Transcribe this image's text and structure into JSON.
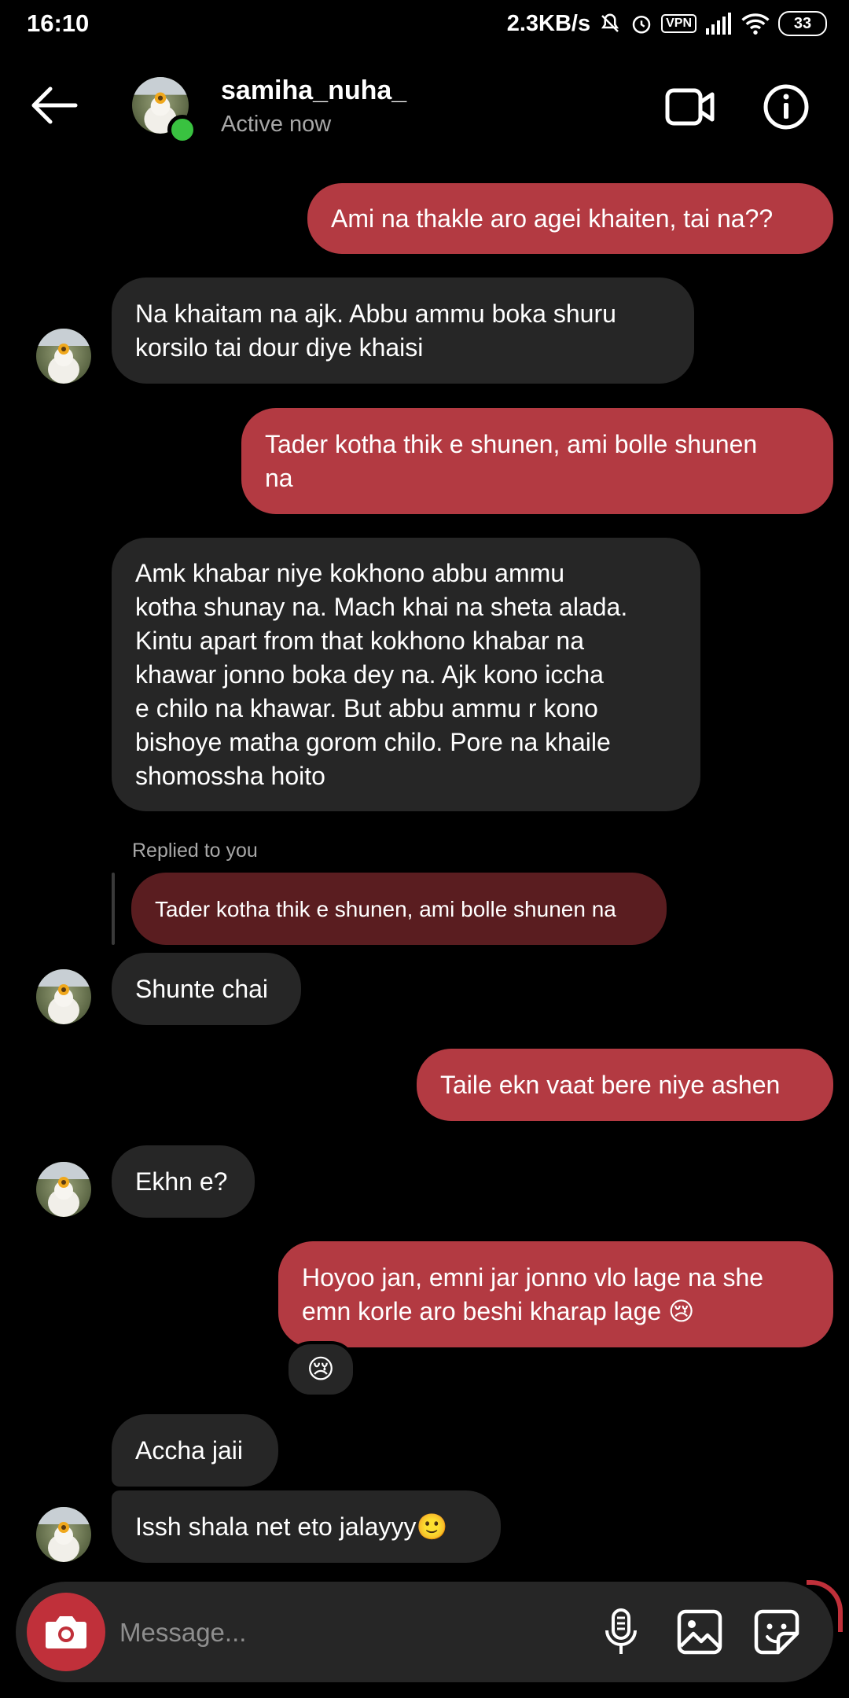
{
  "status_bar": {
    "time": "16:10",
    "speed": "2.3KB/s",
    "vpn": "VPN",
    "battery": "33"
  },
  "header": {
    "username": "samiha_nuha_",
    "status": "Active now"
  },
  "messages": [
    {
      "side": "out",
      "text": "Ami na thakle aro agei khaiten, tai na??"
    },
    {
      "side": "in",
      "text": "Na khaitam na ajk. Abbu ammu boka shuru\nkorsilo tai dour diye khaisi"
    },
    {
      "side": "out",
      "text": "Tader kotha thik e shunen, ami bolle shunen\nna"
    },
    {
      "side": "in",
      "text": "Amk khabar niye kokhono abbu ammu\nkotha shunay na. Mach khai na sheta alada.\nKintu apart from that kokhono khabar na\nkhawar jonno boka dey na. Ajk kono iccha\ne chilo na khawar. But abbu ammu r kono\nbishoye matha gorom chilo. Pore na khaile\nshomossha hoito"
    },
    {
      "side": "in",
      "reply_label": "Replied to you",
      "reply_text": "Tader kotha thik e shunen, ami bolle shunen na",
      "text": "Shunte chai"
    },
    {
      "side": "out",
      "text": "Taile ekn vaat bere niye ashen"
    },
    {
      "side": "in",
      "text": "Ekhn e?"
    },
    {
      "side": "out",
      "text": "Hoyoo jan, emni jar jonno vlo lage na she\nemn korle aro beshi kharap lage 😢",
      "reaction": "😢"
    },
    {
      "side": "in",
      "text": "Accha jaii"
    },
    {
      "side": "in",
      "text": "Issh shala net eto jalayyy🙂"
    }
  ],
  "composer": {
    "placeholder": "Message..."
  },
  "colors": {
    "outgoing_bubble": "#b33a42",
    "incoming_bubble": "#262626",
    "reply_bubble": "#5a1d20",
    "online": "#39c240",
    "camera": "#c0303a"
  },
  "icons": [
    "back-arrow-icon",
    "video-call-icon",
    "info-icon",
    "camera-icon",
    "microphone-icon",
    "gallery-icon",
    "sticker-icon",
    "mute-icon",
    "alarm-icon",
    "signal-icon",
    "wifi-icon"
  ]
}
